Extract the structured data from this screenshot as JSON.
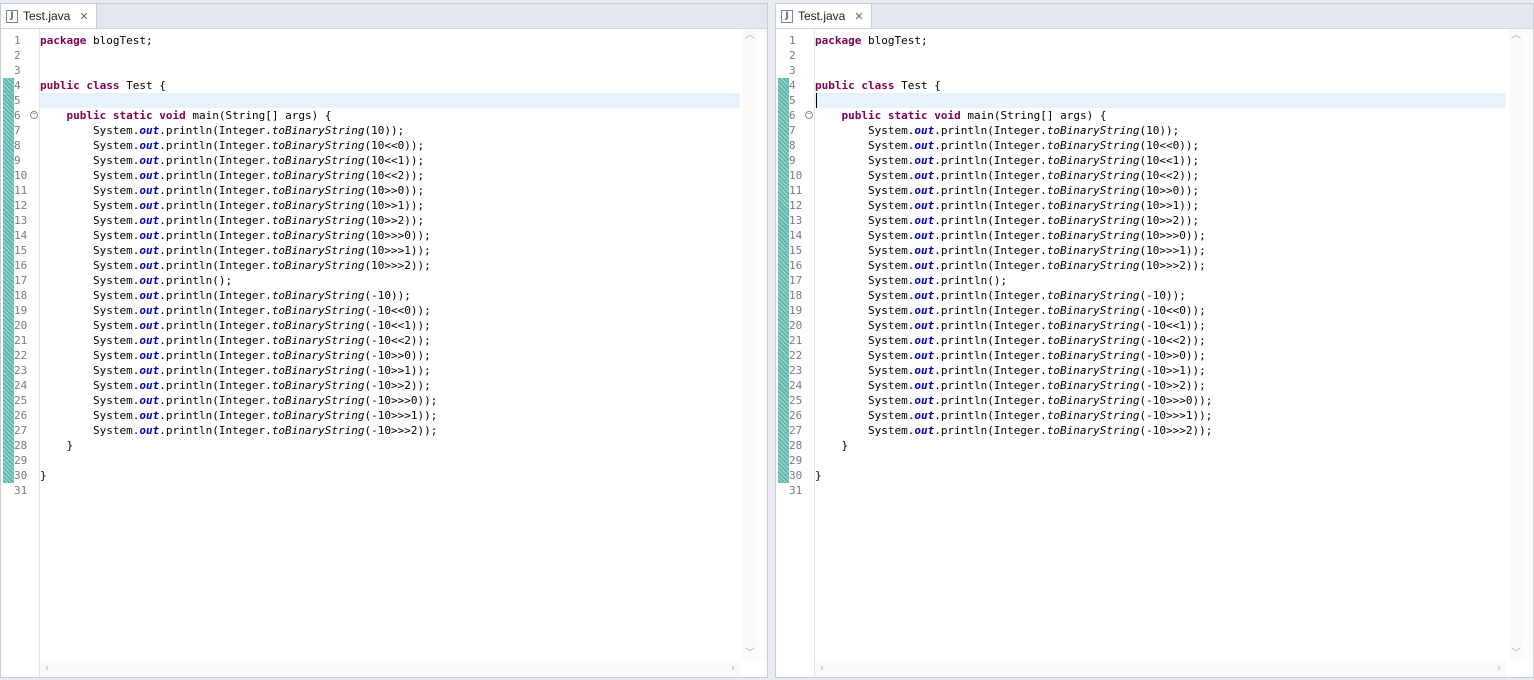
{
  "editors": [
    {
      "tab": {
        "title": "Test.java",
        "icon": "java-file-icon",
        "close_symbol": "✕"
      },
      "cursor_line": 5,
      "show_caret": false
    },
    {
      "tab": {
        "title": "Test.java",
        "icon": "java-file-icon",
        "close_symbol": "✕"
      },
      "cursor_line": 5,
      "show_caret": true
    }
  ],
  "fold_marker_line": 6,
  "change_bars": [
    {
      "from": 4,
      "to": 30
    }
  ],
  "colors": {
    "keyword": "#7f0055",
    "static_field": "#0000c0",
    "change_bar": "#5fb7ae",
    "current_line": "#e8f2fe"
  },
  "code_lines": [
    [
      {
        "t": "package",
        "s": "kw"
      },
      {
        "t": " blogTest;"
      }
    ],
    [],
    [],
    [
      {
        "t": "public",
        "s": "kw"
      },
      {
        "t": " "
      },
      {
        "t": "class",
        "s": "kw"
      },
      {
        "t": " Test {"
      }
    ],
    [],
    [
      {
        "t": "    "
      },
      {
        "t": "public",
        "s": "kw"
      },
      {
        "t": " "
      },
      {
        "t": "static",
        "s": "kw"
      },
      {
        "t": " "
      },
      {
        "t": "void",
        "s": "kw"
      },
      {
        "t": " main(String[] args) {"
      }
    ],
    [
      {
        "t": "        System."
      },
      {
        "t": "out",
        "s": "fld"
      },
      {
        "t": ".println(Integer."
      },
      {
        "t": "toBinaryString",
        "s": "ital"
      },
      {
        "t": "(10));"
      }
    ],
    [
      {
        "t": "        System."
      },
      {
        "t": "out",
        "s": "fld"
      },
      {
        "t": ".println(Integer."
      },
      {
        "t": "toBinaryString",
        "s": "ital"
      },
      {
        "t": "(10<<0));"
      }
    ],
    [
      {
        "t": "        System."
      },
      {
        "t": "out",
        "s": "fld"
      },
      {
        "t": ".println(Integer."
      },
      {
        "t": "toBinaryString",
        "s": "ital"
      },
      {
        "t": "(10<<1));"
      }
    ],
    [
      {
        "t": "        System."
      },
      {
        "t": "out",
        "s": "fld"
      },
      {
        "t": ".println(Integer."
      },
      {
        "t": "toBinaryString",
        "s": "ital"
      },
      {
        "t": "(10<<2));"
      }
    ],
    [
      {
        "t": "        System."
      },
      {
        "t": "out",
        "s": "fld"
      },
      {
        "t": ".println(Integer."
      },
      {
        "t": "toBinaryString",
        "s": "ital"
      },
      {
        "t": "(10>>0));"
      }
    ],
    [
      {
        "t": "        System."
      },
      {
        "t": "out",
        "s": "fld"
      },
      {
        "t": ".println(Integer."
      },
      {
        "t": "toBinaryString",
        "s": "ital"
      },
      {
        "t": "(10>>1));"
      }
    ],
    [
      {
        "t": "        System."
      },
      {
        "t": "out",
        "s": "fld"
      },
      {
        "t": ".println(Integer."
      },
      {
        "t": "toBinaryString",
        "s": "ital"
      },
      {
        "t": "(10>>2));"
      }
    ],
    [
      {
        "t": "        System."
      },
      {
        "t": "out",
        "s": "fld"
      },
      {
        "t": ".println(Integer."
      },
      {
        "t": "toBinaryString",
        "s": "ital"
      },
      {
        "t": "(10>>>0));"
      }
    ],
    [
      {
        "t": "        System."
      },
      {
        "t": "out",
        "s": "fld"
      },
      {
        "t": ".println(Integer."
      },
      {
        "t": "toBinaryString",
        "s": "ital"
      },
      {
        "t": "(10>>>1));"
      }
    ],
    [
      {
        "t": "        System."
      },
      {
        "t": "out",
        "s": "fld"
      },
      {
        "t": ".println(Integer."
      },
      {
        "t": "toBinaryString",
        "s": "ital"
      },
      {
        "t": "(10>>>2));"
      }
    ],
    [
      {
        "t": "        System."
      },
      {
        "t": "out",
        "s": "fld"
      },
      {
        "t": ".println();"
      }
    ],
    [
      {
        "t": "        System."
      },
      {
        "t": "out",
        "s": "fld"
      },
      {
        "t": ".println(Integer."
      },
      {
        "t": "toBinaryString",
        "s": "ital"
      },
      {
        "t": "(-10));"
      }
    ],
    [
      {
        "t": "        System."
      },
      {
        "t": "out",
        "s": "fld"
      },
      {
        "t": ".println(Integer."
      },
      {
        "t": "toBinaryString",
        "s": "ital"
      },
      {
        "t": "(-10<<0));"
      }
    ],
    [
      {
        "t": "        System."
      },
      {
        "t": "out",
        "s": "fld"
      },
      {
        "t": ".println(Integer."
      },
      {
        "t": "toBinaryString",
        "s": "ital"
      },
      {
        "t": "(-10<<1));"
      }
    ],
    [
      {
        "t": "        System."
      },
      {
        "t": "out",
        "s": "fld"
      },
      {
        "t": ".println(Integer."
      },
      {
        "t": "toBinaryString",
        "s": "ital"
      },
      {
        "t": "(-10<<2));"
      }
    ],
    [
      {
        "t": "        System."
      },
      {
        "t": "out",
        "s": "fld"
      },
      {
        "t": ".println(Integer."
      },
      {
        "t": "toBinaryString",
        "s": "ital"
      },
      {
        "t": "(-10>>0));"
      }
    ],
    [
      {
        "t": "        System."
      },
      {
        "t": "out",
        "s": "fld"
      },
      {
        "t": ".println(Integer."
      },
      {
        "t": "toBinaryString",
        "s": "ital"
      },
      {
        "t": "(-10>>1));"
      }
    ],
    [
      {
        "t": "        System."
      },
      {
        "t": "out",
        "s": "fld"
      },
      {
        "t": ".println(Integer."
      },
      {
        "t": "toBinaryString",
        "s": "ital"
      },
      {
        "t": "(-10>>2));"
      }
    ],
    [
      {
        "t": "        System."
      },
      {
        "t": "out",
        "s": "fld"
      },
      {
        "t": ".println(Integer."
      },
      {
        "t": "toBinaryString",
        "s": "ital"
      },
      {
        "t": "(-10>>>0));"
      }
    ],
    [
      {
        "t": "        System."
      },
      {
        "t": "out",
        "s": "fld"
      },
      {
        "t": ".println(Integer."
      },
      {
        "t": "toBinaryString",
        "s": "ital"
      },
      {
        "t": "(-10>>>1));"
      }
    ],
    [
      {
        "t": "        System."
      },
      {
        "t": "out",
        "s": "fld"
      },
      {
        "t": ".println(Integer."
      },
      {
        "t": "toBinaryString",
        "s": "ital"
      },
      {
        "t": "(-10>>>2));"
      }
    ],
    [
      {
        "t": "    }"
      }
    ],
    [],
    [
      {
        "t": "}"
      }
    ],
    []
  ]
}
